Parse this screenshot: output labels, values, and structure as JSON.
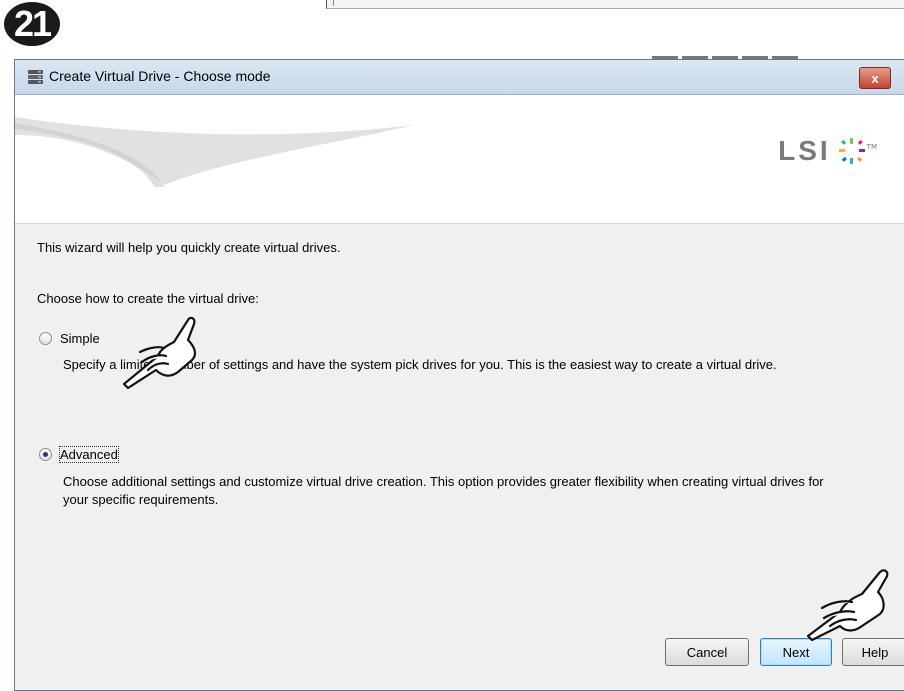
{
  "step_badge": "21",
  "dialog": {
    "title": "Create Virtual Drive - Choose mode",
    "close_label": "x",
    "logo_text": "LSI"
  },
  "content": {
    "intro": "This wizard will help you quickly create virtual drives.",
    "choose_prompt": "Choose how to create the virtual drive:",
    "options": [
      {
        "label": "Simple",
        "selected": false,
        "description": "Specify a limited number of settings and have the system pick drives for you. This is the easiest way to create a virtual drive."
      },
      {
        "label": "Advanced",
        "selected": true,
        "description": "Choose additional settings and customize virtual drive creation. This option provides greater flexibility when creating virtual drives for your specific requirements."
      }
    ]
  },
  "buttons": {
    "cancel": "Cancel",
    "next": "Next",
    "help": "Help"
  },
  "icons": [
    "database-icon",
    "close-icon",
    "lsi-logo-icon",
    "pointing-hand-icon"
  ]
}
